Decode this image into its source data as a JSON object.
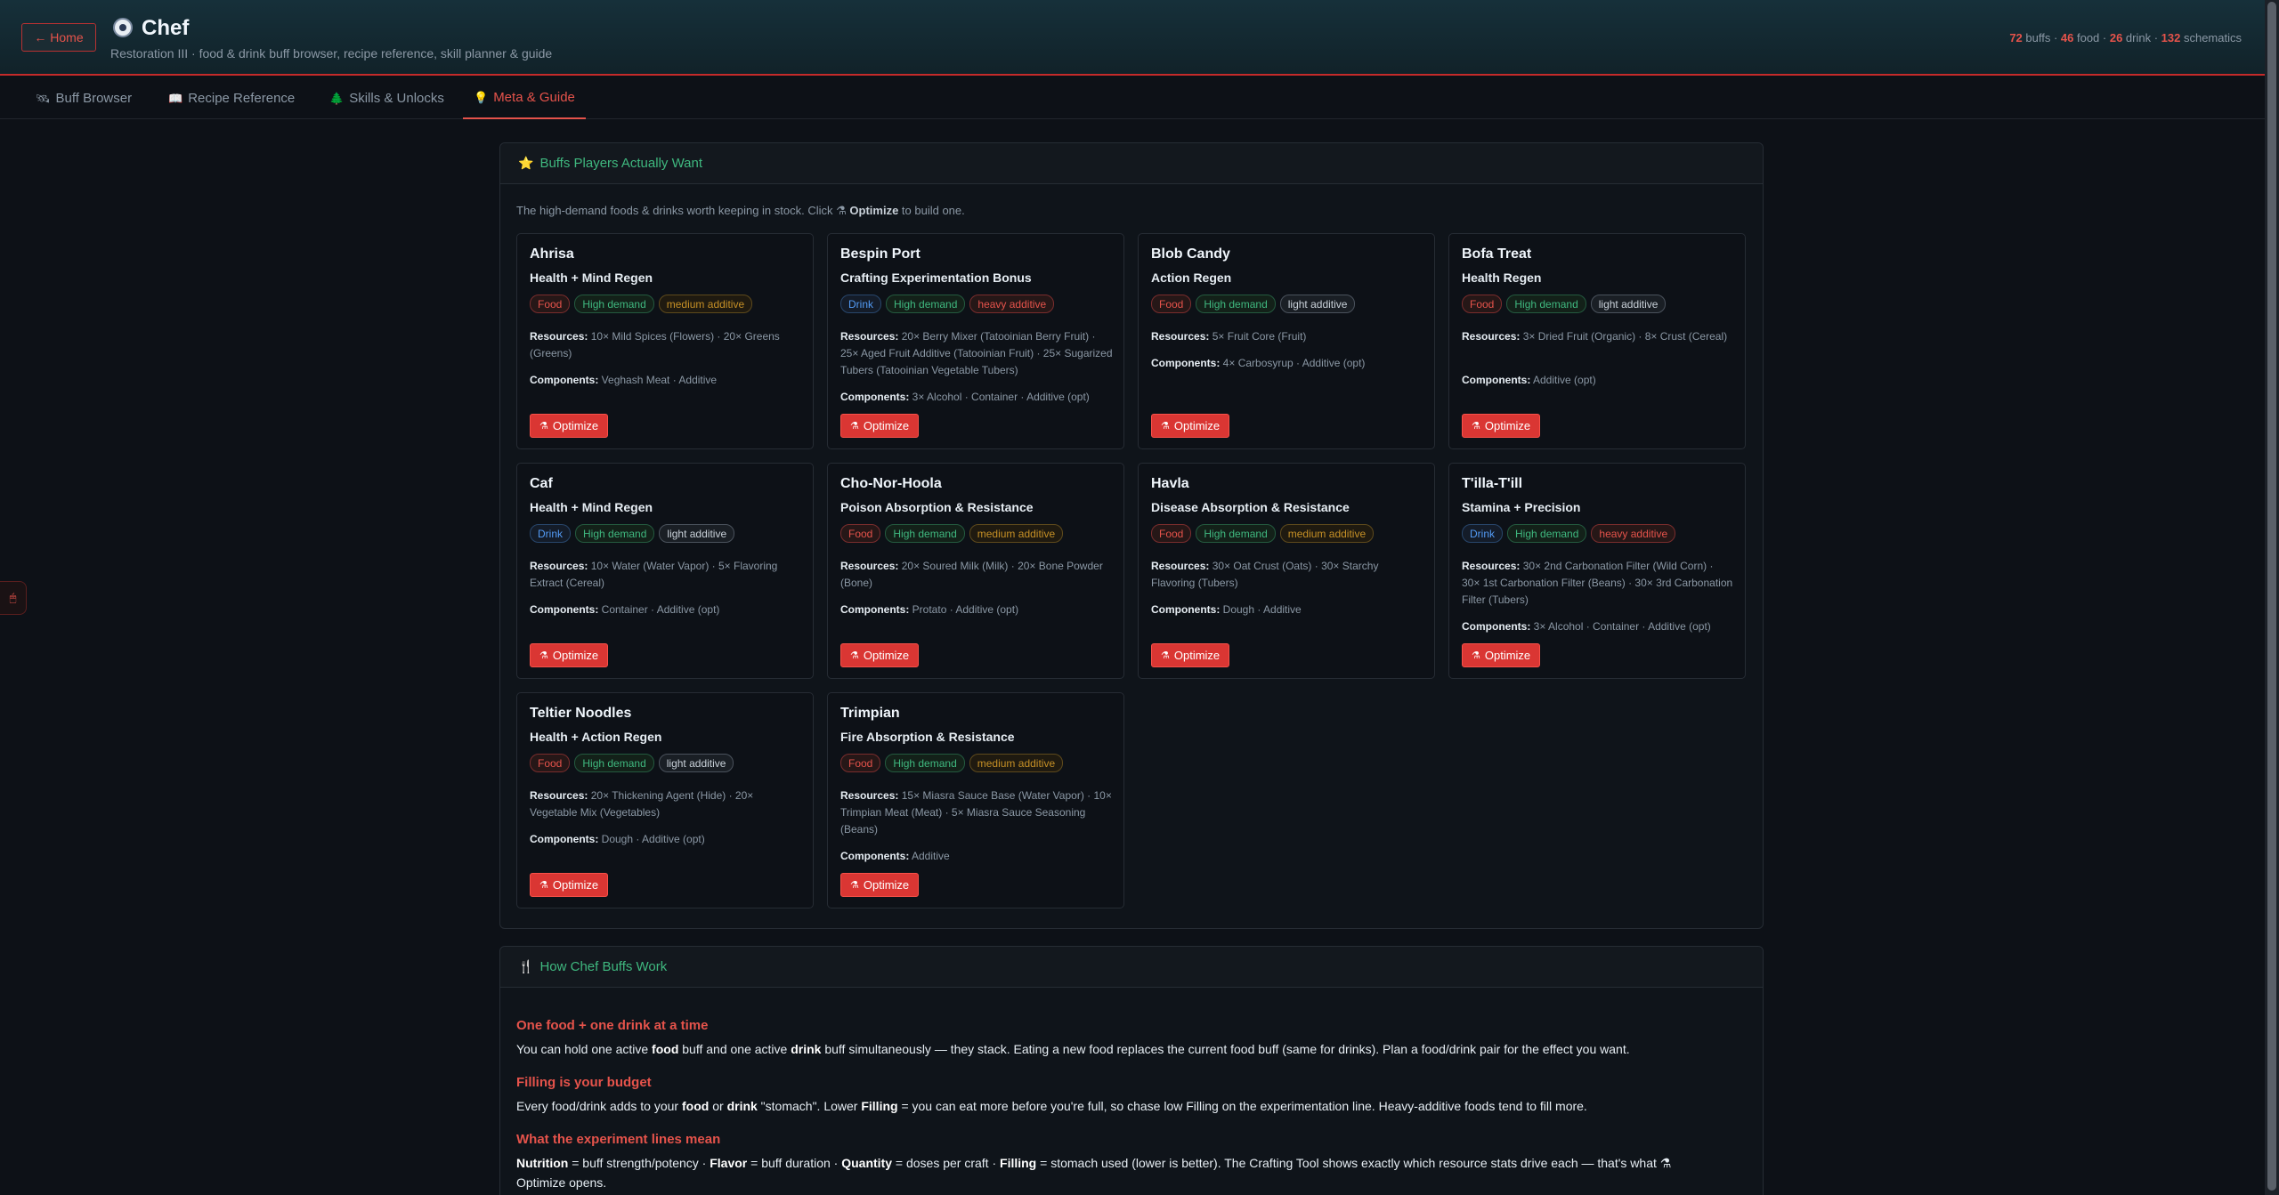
{
  "header": {
    "home_label": "← Home",
    "title": "Chef",
    "subtitle": "Restoration III · food & drink buff browser, recipe reference, skill planner & guide",
    "stats": {
      "buffs": "72",
      "buffs_label": " buffs · ",
      "food": "46",
      "food_label": " food · ",
      "drink": "26",
      "drink_label": " drink · ",
      "schematics": "132",
      "schematics_label": " schematics"
    }
  },
  "tabs": [
    {
      "icon": "🛰",
      "label": "Buff Browser"
    },
    {
      "icon": "📖",
      "label": "Recipe Reference"
    },
    {
      "icon": "🌲",
      "label": "Skills & Unlocks"
    },
    {
      "icon": "💡",
      "label": "Meta & Guide"
    }
  ],
  "side_handle_icon": "🖱",
  "wanted": {
    "title": "Buffs Players Actually Want",
    "intro_a": "The high-demand foods & drinks worth keeping in stock. Click ",
    "intro_icon": "⚗",
    "intro_b": "Optimize",
    "intro_c": " to build one.",
    "res_label": "Resources:",
    "comp_label": "Components:",
    "optimize_icon": "⚗",
    "optimize_label": "Optimize",
    "cards": [
      {
        "name": "Ahrisa",
        "buff": "Health + Mind Regen",
        "type": "Food",
        "demand": "High demand",
        "additive": "medium additive",
        "resources": "10× Mild Spices (Flowers) · 20× Greens (Greens)",
        "components": "Veghash Meat · Additive"
      },
      {
        "name": "Bespin Port",
        "buff": "Crafting Experimentation Bonus",
        "type": "Drink",
        "demand": "High demand",
        "additive": "heavy additive",
        "resources": "20× Berry Mixer (Tatooinian Berry Fruit) · 25× Aged Fruit Additive (Tatooinian Fruit) · 25× Sugarized Tubers (Tatooinian Vegetable Tubers)",
        "components": "3× Alcohol · Container · Additive (opt)"
      },
      {
        "name": "Blob Candy",
        "buff": "Action Regen",
        "type": "Food",
        "demand": "High demand",
        "additive": "light additive",
        "resources": "5× Fruit Core (Fruit)",
        "components": "4× Carbosyrup · Additive (opt)"
      },
      {
        "name": "Bofa Treat",
        "buff": "Health Regen",
        "type": "Food",
        "demand": "High demand",
        "additive": "light additive",
        "resources": "3× Dried Fruit (Organic) · 8× Crust (Cereal)",
        "components": "Additive (opt)"
      },
      {
        "name": "Caf",
        "buff": "Health + Mind Regen",
        "type": "Drink",
        "demand": "High demand",
        "additive": "light additive",
        "resources": "10× Water (Water Vapor) · 5× Flavoring Extract (Cereal)",
        "components": "Container · Additive (opt)"
      },
      {
        "name": "Cho-Nor-Hoola",
        "buff": "Poison Absorption & Resistance",
        "type": "Food",
        "demand": "High demand",
        "additive": "medium additive",
        "resources": "20× Soured Milk (Milk) · 20× Bone Powder (Bone)",
        "components": "Protato · Additive (opt)"
      },
      {
        "name": "Havla",
        "buff": "Disease Absorption & Resistance",
        "type": "Food",
        "demand": "High demand",
        "additive": "medium additive",
        "resources": "30× Oat Crust (Oats) · 30× Starchy Flavoring (Tubers)",
        "components": "Dough · Additive"
      },
      {
        "name": "T'illa-T'ill",
        "buff": "Stamina + Precision",
        "type": "Drink",
        "demand": "High demand",
        "additive": "heavy additive",
        "resources": "30× 2nd Carbonation Filter (Wild Corn) · 30× 1st Carbonation Filter (Beans) · 30× 3rd Carbonation Filter (Tubers)",
        "components": "3× Alcohol · Container · Additive (opt)"
      },
      {
        "name": "Teltier Noodles",
        "buff": "Health + Action Regen",
        "type": "Food",
        "demand": "High demand",
        "additive": "light additive",
        "resources": "20× Thickening Agent (Hide) · 20× Vegetable Mix (Vegetables)",
        "components": "Dough · Additive (opt)"
      },
      {
        "name": "Trimpian",
        "buff": "Fire Absorption & Resistance",
        "type": "Food",
        "demand": "High demand",
        "additive": "medium additive",
        "resources": "15× Miasra Sauce Base (Water Vapor) · 10× Trimpian Meat (Meat) · 5× Miasra Sauce Seasoning (Beans)",
        "components": "Additive"
      }
    ]
  },
  "guide": {
    "title": "How Chef Buffs Work",
    "s1_title": "One food + one drink at a time",
    "s1_a": "You can hold one active ",
    "s1_b": "food",
    "s1_c": " buff and one active ",
    "s1_d": "drink",
    "s1_e": " buff simultaneously — they stack. Eating a new food replaces the current food buff (same for drinks). Plan a food/drink pair for the effect you want.",
    "s2_title": "Filling is your budget",
    "s2_a": "Every food/drink adds to your ",
    "s2_b": "food",
    "s2_c": " or ",
    "s2_d": "drink",
    "s2_e": " \"stomach\". Lower ",
    "s2_f": "Filling",
    "s2_g": " = you can eat more before you're full, so chase low Filling on the experimentation line. Heavy-additive foods tend to fill more.",
    "s3_title": "What the experiment lines mean",
    "s3_a": "Nutrition",
    "s3_b": " = buff strength/potency · ",
    "s3_c": "Flavor",
    "s3_d": " = buff duration · ",
    "s3_e": "Quantity",
    "s3_f": " = doses per craft · ",
    "s3_g": "Filling",
    "s3_h": " = stomach used (lower is better). The Crafting Tool shows exactly which resource stats drive each — that's what ",
    "s3_icon": "⚗",
    "s3_i": " Optimize opens."
  },
  "colors": {
    "accent": "#e5534b",
    "green": "#3fb87f",
    "background": "#0d1117"
  }
}
